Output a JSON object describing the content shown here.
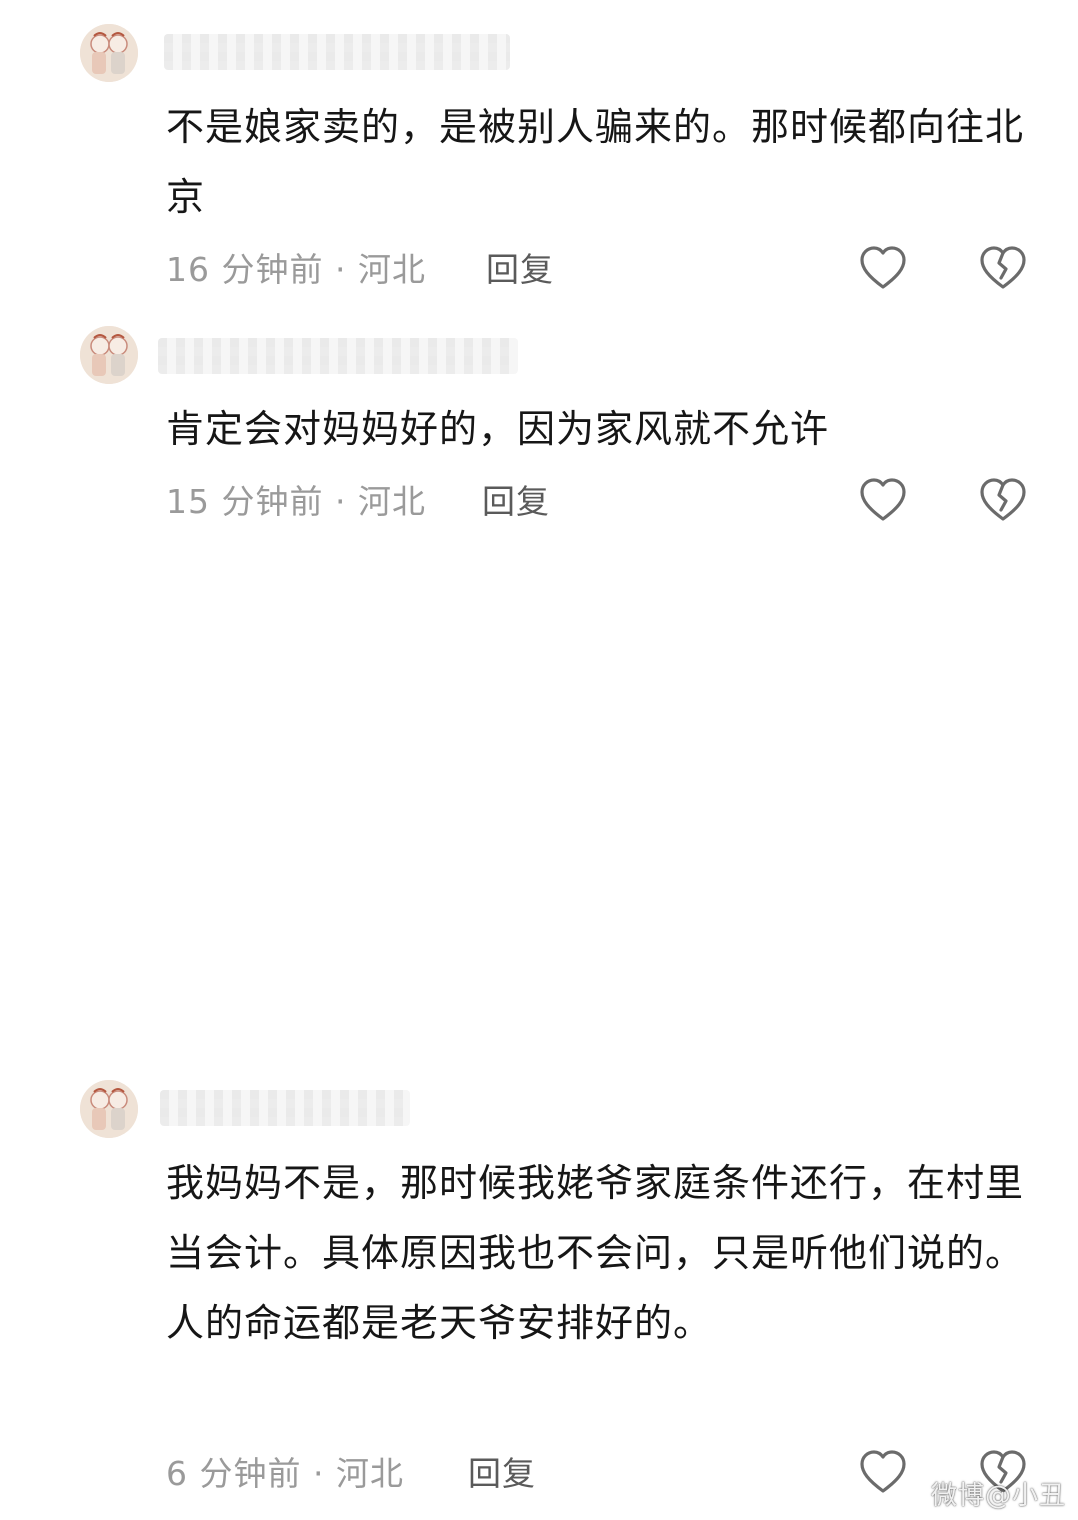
{
  "comments": [
    {
      "text": "不是娘家卖的，是被别人骗来的。那时候都向往北京",
      "time": "16 分钟前",
      "location": "河北",
      "reply_label": "回复"
    },
    {
      "text": "肯定会对妈妈好的，因为家风就不允许",
      "time": "15 分钟前",
      "location": "河北",
      "reply_label": "回复"
    },
    {
      "text": "我妈妈不是，那时候我姥爷家庭条件还行，在村里当会计。具体原因我也不会问，只是听他们说的。人的命运都是老天爷安排好的。",
      "time": "6 分钟前",
      "location": "河北",
      "reply_label": "回复"
    }
  ],
  "meta_separator": " · ",
  "icons": {
    "like": "heart-outline-icon",
    "dislike": "broken-heart-icon",
    "avatar": "avatar-icon"
  },
  "colors": {
    "text": "#161616",
    "meta": "#9a9a9a",
    "reply": "#5a5a5a",
    "icon": "#6b6b6b"
  },
  "watermark": "微博@小丑"
}
